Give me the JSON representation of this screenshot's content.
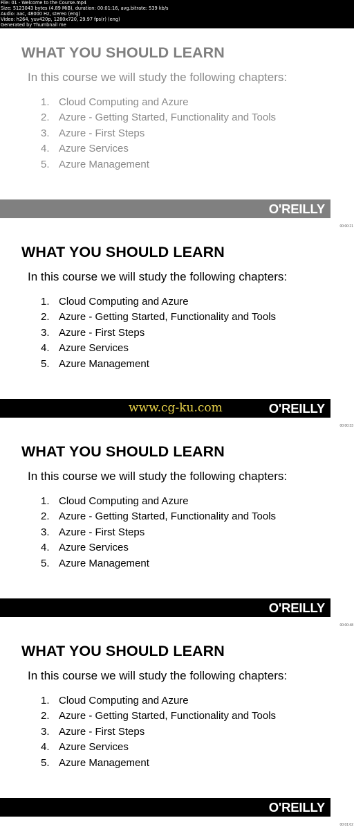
{
  "header": {
    "lines": [
      "File: 01 - Welcome to the Course.mp4",
      "Size: 5123043 bytes (4.89 MiB), duration: 00:01:16, avg.bitrate: 539 kb/s",
      "Audio: aac, 48000 Hz, stereo (eng)",
      "Video: h264, yuv420p, 1280x720, 29.97 fps(r) (eng)",
      "Generated by Thumbnail me"
    ]
  },
  "slide": {
    "title": "WHAT YOU SHOULD LEARN",
    "intro": "In this course we will study the following chapters:",
    "chapters": [
      {
        "num": "1.",
        "label": "Cloud Computing and Azure"
      },
      {
        "num": "2.",
        "label": "Azure - Getting Started, Functionality and Tools"
      },
      {
        "num": "3.",
        "label": "Azure - First Steps"
      },
      {
        "num": "4.",
        "label": "Azure Services"
      },
      {
        "num": "5.",
        "label": "Azure Management"
      }
    ],
    "logo": "O'REILLY"
  },
  "frames": [
    {
      "timestamp": "00:00:21",
      "style": "faded"
    },
    {
      "timestamp": "00:00:33",
      "style": "solid",
      "watermark": "www.cg-ku.com"
    },
    {
      "timestamp": "00:00:48",
      "style": "solid"
    },
    {
      "timestamp": "00:01:02",
      "style": "solid"
    }
  ],
  "colors": {
    "faded_bar": "#808080",
    "solid_bar": "#000000",
    "watermark": "#e8d24a"
  }
}
